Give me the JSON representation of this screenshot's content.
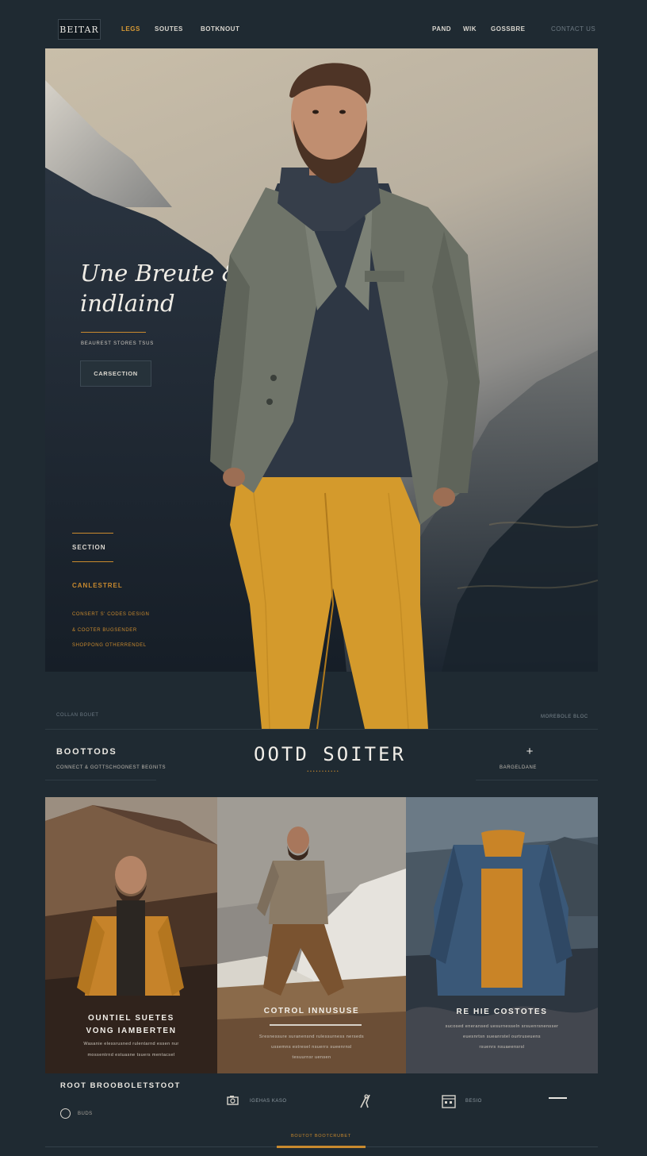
{
  "nav": {
    "logo": "BEITAR",
    "links_left": [
      "LEGS",
      "SOUTES",
      "BOTKNOUT"
    ],
    "links_right": [
      "PAND",
      "WIK",
      "GOSSBRE"
    ],
    "utility": "CONTACT US"
  },
  "hero": {
    "headline_line1": "Une Breute &",
    "headline_line2": "indlaind",
    "subtitle": "BEAUREST STORES TSUS",
    "cta_label": "CARSECTION",
    "side_label": "SECTION",
    "side_label_orange": "CANLESTREL",
    "side_lines": [
      "CONSERT S' CODES DESIGN",
      "& COOTER BUGSENDER",
      "SHOPPONG OTHERRENDEL"
    ]
  },
  "section": {
    "meta_left": "COLLAN BOUET",
    "meta_right": "MOREBOLE BLOC",
    "left_title": "BOOTTODS",
    "left_sub": "CONNECT & GOTTSCHOONEST BEGNITS",
    "title": "OOTD SOITER",
    "title_sub": "•••••••••••",
    "plus": "+",
    "right_sub": "BARGELDANE"
  },
  "cards": [
    {
      "title_line1": "OUNTIEL SUETES",
      "title_line2": "VONG IAMBERTEN",
      "text_lines": [
        "Wasanie elessrusned rulentarnd essen nur",
        "mossentrnd estuasne tsuers mentacsel"
      ]
    },
    {
      "title_line1": "COTROL INNUSUSE",
      "title_line2": "",
      "text_lines": [
        "Sresnessure suranensnd rulessurness nerseds",
        "ussemns estresel nsuerrs sueenrnsl",
        "tesuurnsr uensen"
      ]
    },
    {
      "title_line1": "RE HIE COSTOTES",
      "title_line2": "",
      "text_lines": [
        "sucosed eneransed uesurnesseln srsuenrsnensser",
        "euesnrtsn sueanrstel ourtruseuens",
        "rsuenrs nsuaeensrsl"
      ]
    }
  ],
  "footer": {
    "title": "ROOT BROOBOLETSTOOT",
    "radio_label": "BUDS",
    "items": [
      {
        "icon": "camera-icon",
        "label": "IGEHAS KASO"
      },
      {
        "icon": "tools-icon",
        "label": ""
      },
      {
        "icon": "calendar-icon",
        "label": "BESIO"
      }
    ],
    "active_tab": "BOUTOT BOOTCRUBET"
  },
  "colors": {
    "background": "#1f2a32",
    "accent": "#c98a2e",
    "mustard": "#d49a2c"
  }
}
